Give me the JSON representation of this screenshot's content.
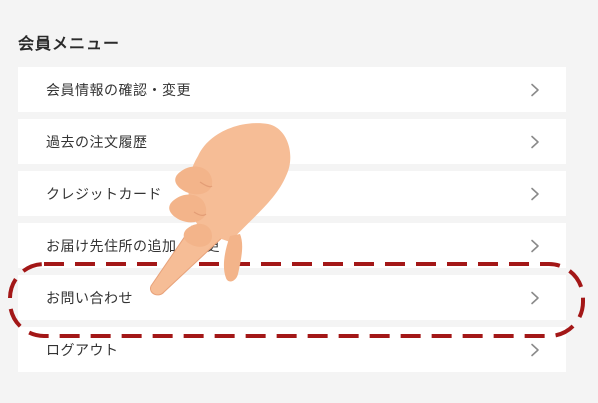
{
  "section": {
    "title": "会員メニュー"
  },
  "menu": {
    "items": [
      {
        "label": "会員情報の確認・変更"
      },
      {
        "label": "過去の注文履歴"
      },
      {
        "label": "クレジットカード"
      },
      {
        "label": "お届け先住所の追加・変更"
      },
      {
        "label": "お問い合わせ"
      },
      {
        "label": "ログアウト"
      }
    ],
    "chevron_icon": "chevron-right-icon"
  },
  "annotation": {
    "highlight_color": "#a31717",
    "highlighted_item": "お問い合わせ",
    "pointer_icon": "pointing-hand-icon"
  },
  "colors": {
    "background": "#f4f4f4",
    "item_background": "#ffffff",
    "text": "#333333",
    "chevron": "#8a8a8a",
    "hand": "#f6bd96"
  }
}
